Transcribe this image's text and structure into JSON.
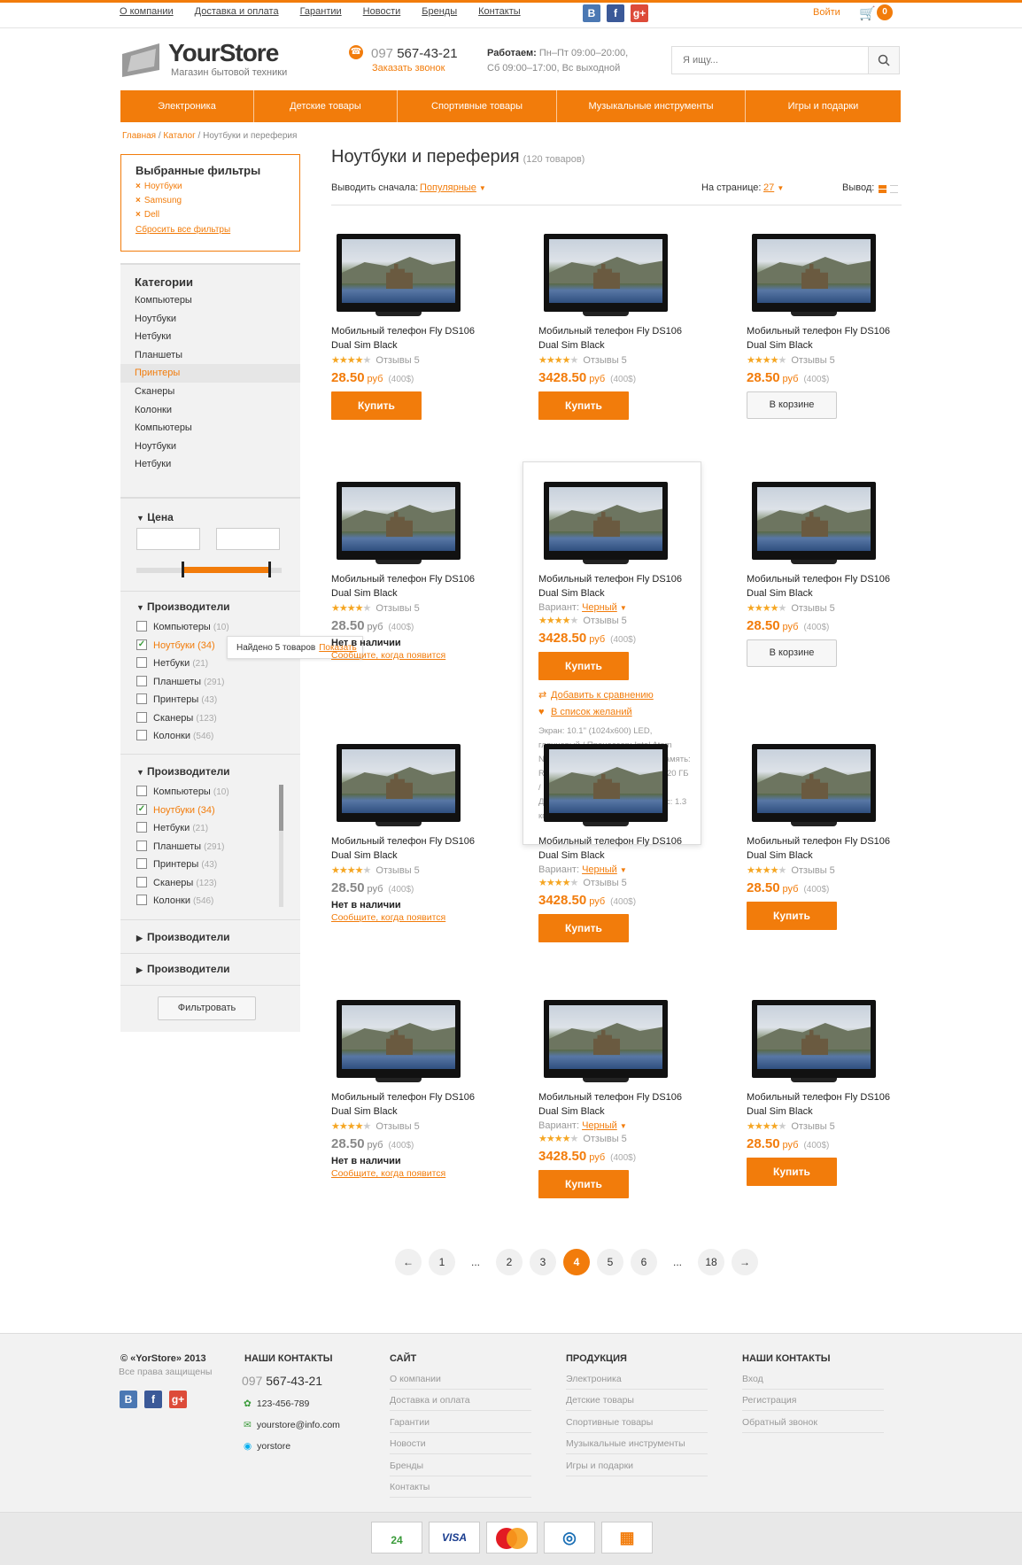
{
  "topnav": [
    "О компании",
    "Доставка и оплата",
    "Гарантии",
    "Новости",
    "Бренды",
    "Контакты"
  ],
  "social": [
    {
      "name": "vk",
      "label": "B",
      "color": "#4b78b3"
    },
    {
      "name": "facebook",
      "label": "f",
      "color": "#3b5998"
    },
    {
      "name": "googleplus",
      "label": "g+",
      "color": "#dd4b39"
    }
  ],
  "account": {
    "login": "Войти",
    "cart_count": "0"
  },
  "logo": {
    "title": "YourStore",
    "subtitle": "Магазин бытовой техники"
  },
  "phone": {
    "prefix": "097",
    "number": "567-43-21",
    "callback": "Заказать звонок"
  },
  "hours": {
    "label": "Работаем:",
    "line1": "Пн–Пт 09:00–20:00,",
    "line2": "Сб 09:00–17:00, Вс выходной"
  },
  "search": {
    "placeholder": "Я ищу..."
  },
  "mainnav": [
    "Электроника",
    "Детские товары",
    "Спортивные товары",
    "Музыкальные инструменты",
    "Игры и подарки"
  ],
  "breadcrumb": {
    "home": "Главная",
    "catalog": "Каталог",
    "current": "Ноутбуки и перeферия"
  },
  "selected_filters": {
    "title": "Выбранные фильтры",
    "items": [
      "Ноутбуки",
      "Samsung",
      "Dell"
    ],
    "reset": "Сбросить все фильтры"
  },
  "categories": {
    "title": "Категории",
    "items": [
      "Компьютеры",
      "Ноутбуки",
      "Нетбуки",
      "Планшеты",
      "Принтеры",
      "Сканеры",
      "Колонки",
      "Компьютеры",
      "Ноутбуки",
      "Нетбуки"
    ],
    "active_index": 4
  },
  "price_filter": {
    "title": "Цена"
  },
  "groups": [
    {
      "title": "Производители",
      "items": [
        {
          "label": "Компьютеры",
          "count": "(10)"
        },
        {
          "label": "Ноутбуки",
          "count": "(34)"
        },
        {
          "label": "Нетбуки",
          "count": "(21)"
        },
        {
          "label": "Планшеты",
          "count": "(291)"
        },
        {
          "label": "Принтеры",
          "count": "(43)"
        },
        {
          "label": "Сканеры",
          "count": "(123)"
        },
        {
          "label": "Колонки",
          "count": "(546)"
        }
      ]
    },
    {
      "title": "Производители",
      "items": [
        {
          "label": "Компьютеры",
          "count": "(10)"
        },
        {
          "label": "Ноутбуки",
          "count": "(34)"
        },
        {
          "label": "Нетбуки",
          "count": "(21)"
        },
        {
          "label": "Планшеты",
          "count": "(291)"
        },
        {
          "label": "Принтеры",
          "count": "(43)"
        },
        {
          "label": "Сканеры",
          "count": "(123)"
        },
        {
          "label": "Колонки",
          "count": "(546)"
        }
      ]
    },
    {
      "title": "Производители"
    },
    {
      "title": "Производители"
    }
  ],
  "tooltip": {
    "text": "Найдено 5 товаров",
    "link": "Показать"
  },
  "filter_button": "Фильтровать",
  "page": {
    "title": "Ноутбуки и перeферия",
    "count": "(120 товаров)"
  },
  "sort": {
    "label": "Выводить сначала:",
    "value": "Популярные",
    "per_page_label": "На странице:",
    "per_page": "27",
    "view_label": "Вывод:"
  },
  "product": {
    "name1": "Мобильный телефон Fly DS106",
    "name2": "Dual Sim Black",
    "reviews": "Отзывы 5",
    "variant_label": "Вариант:",
    "variant": "Черный",
    "price_low": "28.50",
    "price_high": "3428.50",
    "currency": "руб",
    "old": "(400$)",
    "buy": "Купить",
    "in_cart": "В корзине",
    "out_of_stock": "Нет в наличии",
    "notify": "Сообщите, когда появится",
    "compare": "Добавить к сравнению",
    "wishlist": "В список желаний",
    "specs": "Экран: 10.1\" (1024x600) LED, глянцевый / Процессор: Intel Atom N2600 (1.6 ГГц) / Оперативная память: RAM 2 ГБ / Жесткий диск: HDD 320 ГБ / Наличие Wi-Fi: есть / Дополнительно: веб-камера / Вес: 1.3 кг / Цвет: синий",
    "rating": 4
  },
  "pager": [
    "←",
    "1",
    "...",
    "2",
    "3",
    "4",
    "5",
    "6",
    "...",
    "18",
    "→"
  ],
  "pager_current": "4",
  "footer": {
    "copyright": "© «YorStore» 2013",
    "rights": "Все права защищены",
    "contacts_title": "НАШИ КОНТАКТЫ",
    "phone_prefix": "097",
    "phone": "567-43-21",
    "icq": "123-456-789",
    "email": "yourstore@info.com",
    "skype": "yorstore",
    "site_title": "САЙТ",
    "site": [
      "О компании",
      "Доставка и оплата",
      "Гарантии",
      "Новости",
      "Бренды",
      "Контакты"
    ],
    "products_title": "ПРОДУКЦИЯ",
    "products": [
      "Электроника",
      "Детские товары",
      "Спортивные товары",
      "Музыкальные инструменты",
      "Игры и подарки"
    ],
    "contacts2_title": "НАШИ КОНТАКТЫ",
    "contacts2": [
      "Вход",
      "Регистрация",
      "Обратный звонок"
    ]
  },
  "payments": [
    "24",
    "VISA",
    "MasterCard",
    "WebMoney",
    "Yandex"
  ],
  "colors": {
    "accent": "#f27c0b"
  }
}
